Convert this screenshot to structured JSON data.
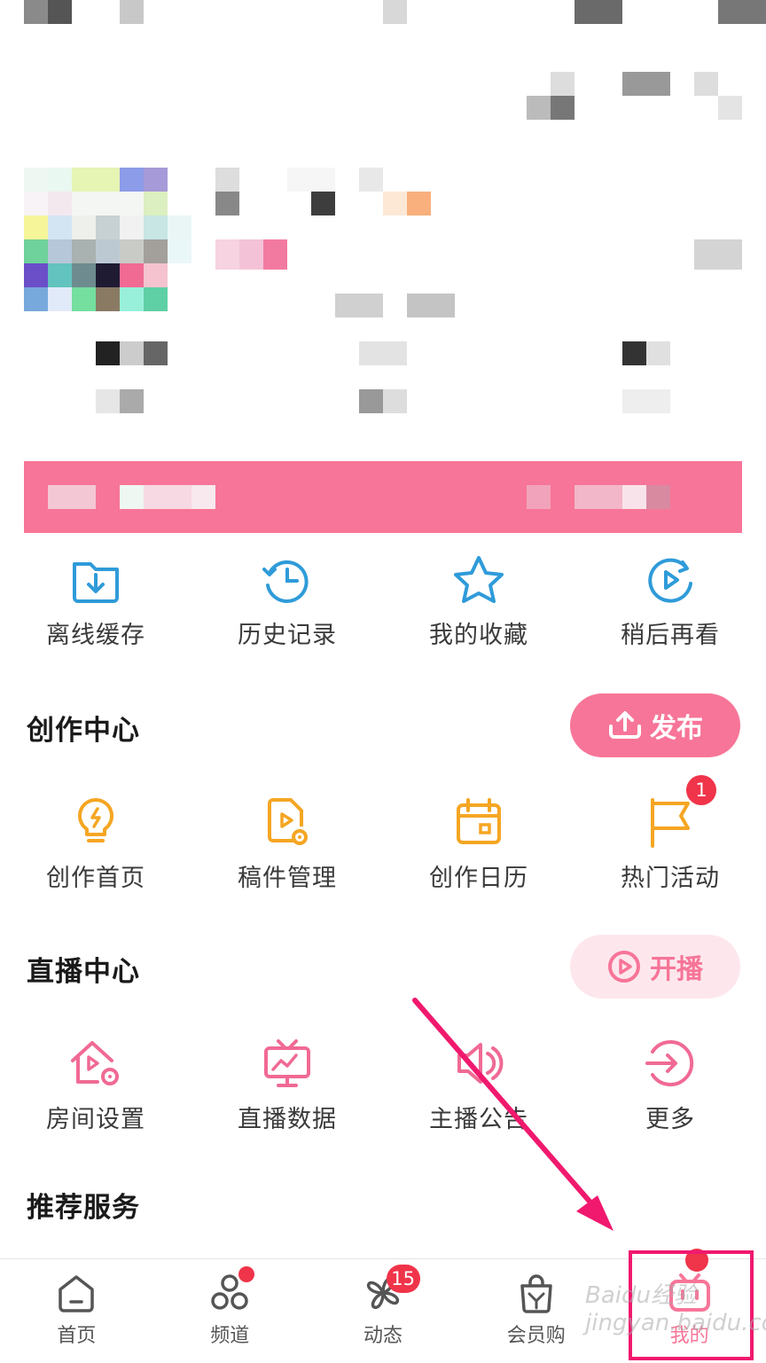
{
  "quick_actions": [
    {
      "label": "离线缓存",
      "icon": "download-folder-icon"
    },
    {
      "label": "历史记录",
      "icon": "history-clock-icon"
    },
    {
      "label": "我的收藏",
      "icon": "star-icon"
    },
    {
      "label": "稍后再看",
      "icon": "watch-later-icon"
    }
  ],
  "creation_center": {
    "title": "创作中心",
    "publish_label": "发布",
    "items": [
      {
        "label": "创作首页",
        "icon": "lightbulb-icon"
      },
      {
        "label": "稿件管理",
        "icon": "manuscript-icon"
      },
      {
        "label": "创作日历",
        "icon": "calendar-icon"
      },
      {
        "label": "热门活动",
        "icon": "flag-icon",
        "badge": "1"
      }
    ]
  },
  "live_center": {
    "title": "直播中心",
    "start_live_label": "开播",
    "items": [
      {
        "label": "房间设置",
        "icon": "room-settings-icon"
      },
      {
        "label": "直播数据",
        "icon": "live-data-icon"
      },
      {
        "label": "主播公告",
        "icon": "announcement-icon"
      },
      {
        "label": "更多",
        "icon": "more-arrow-icon"
      }
    ]
  },
  "recommended_services": {
    "title": "推荐服务"
  },
  "tabs": [
    {
      "label": "首页",
      "icon": "home-icon"
    },
    {
      "label": "频道",
      "icon": "channel-icon"
    },
    {
      "label": "动态",
      "icon": "pinwheel-icon",
      "badge": "15"
    },
    {
      "label": "会员购",
      "icon": "shopping-bag-icon"
    },
    {
      "label": "我的",
      "icon": "tv-mascot-icon"
    }
  ],
  "watermark": "Baidu经验 jingyan.baidu.com",
  "colors": {
    "pink": "#f77598",
    "blue": "#2f9bd9",
    "orange": "#f5a623",
    "badge": "#f0344a"
  }
}
